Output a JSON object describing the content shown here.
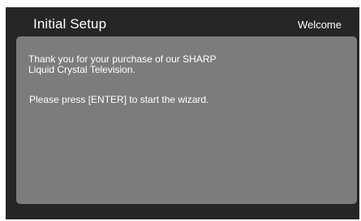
{
  "header": {
    "title": "Initial Setup",
    "step_label": "Welcome"
  },
  "content": {
    "message_1": "Thank you for your purchase of our SHARP Liquid Crystal Television.",
    "message_2": "Please press [ENTER] to start the wizard."
  },
  "colors": {
    "background": "#262626",
    "panel": "#7c7c7c",
    "text": "#ffffff"
  }
}
